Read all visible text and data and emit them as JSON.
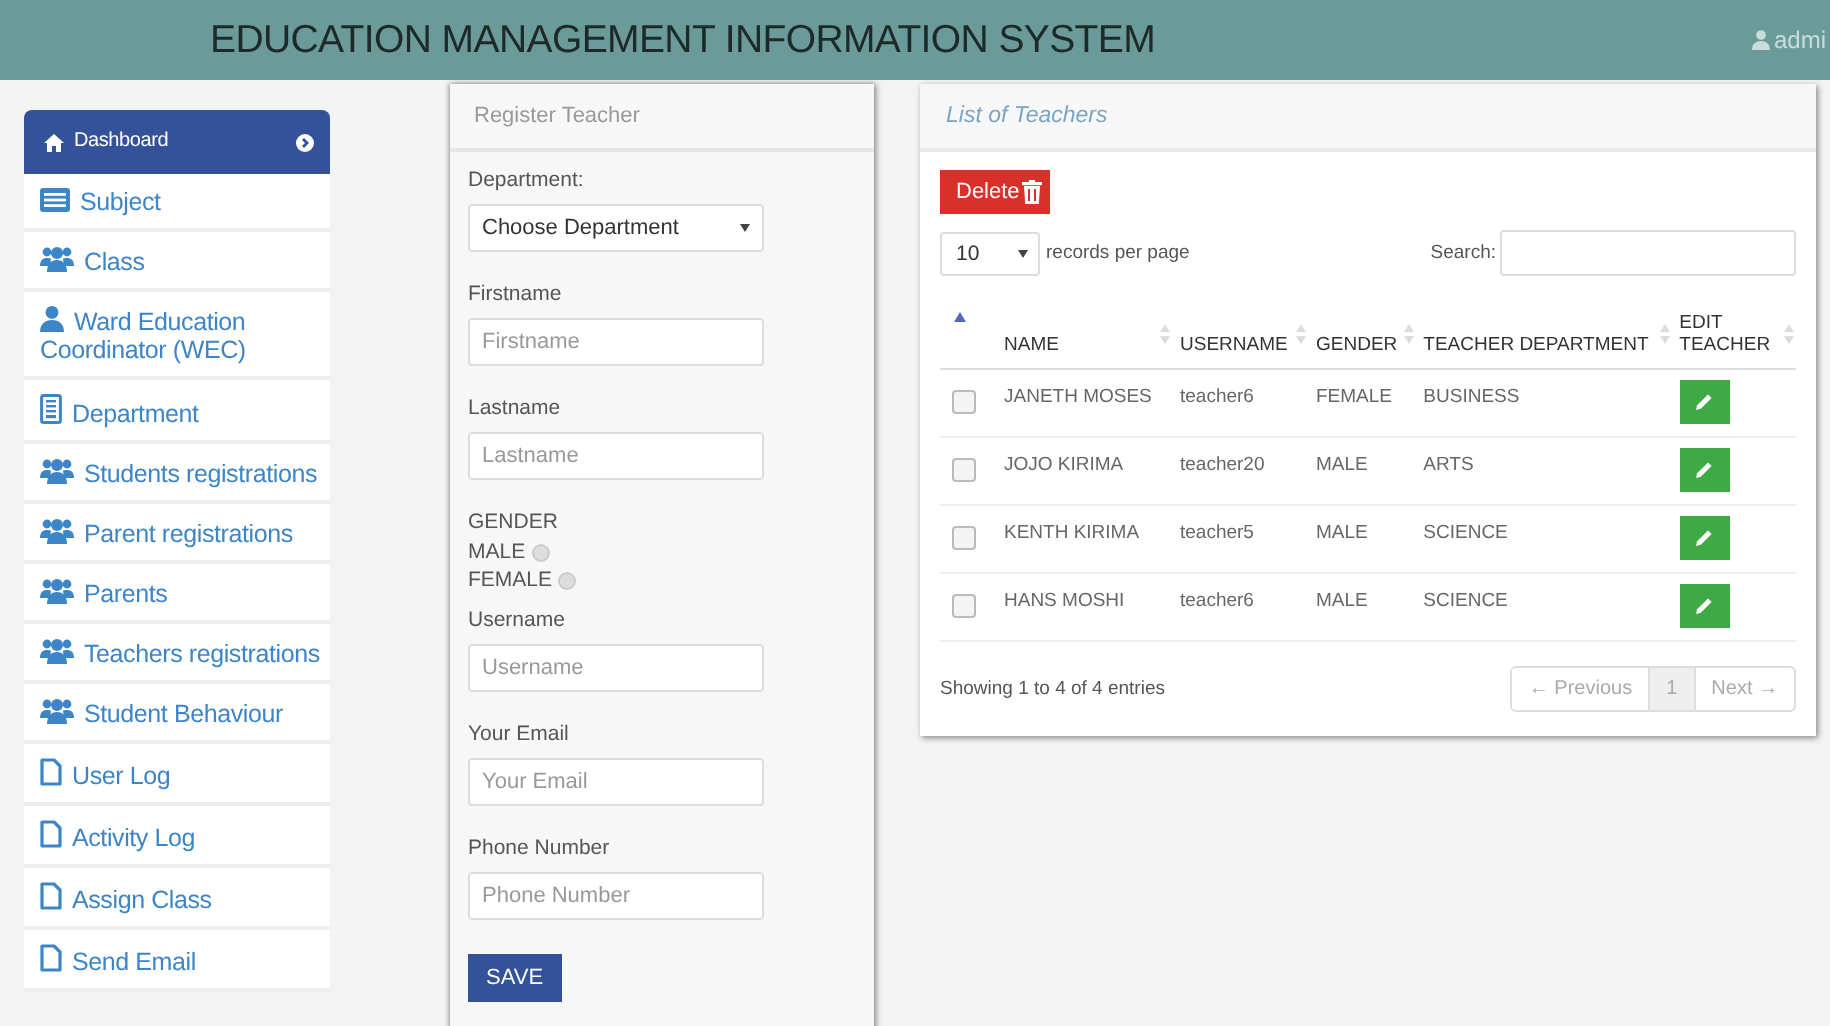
{
  "header": {
    "title": "EDUCATION MANAGEMENT INFORMATION SYSTEM",
    "user": "admi"
  },
  "sidebar": {
    "items": [
      {
        "label": "Dashboard",
        "kind": "header"
      },
      {
        "label": "Subject",
        "kind": "list"
      },
      {
        "label": "Class",
        "kind": "group"
      },
      {
        "label": "Ward Education Coordinator (WEC)",
        "kind": "person"
      },
      {
        "label": "Department",
        "kind": "building"
      },
      {
        "label": "Students registrations",
        "kind": "group"
      },
      {
        "label": "Parent registrations",
        "kind": "group"
      },
      {
        "label": "Parents",
        "kind": "group"
      },
      {
        "label": "Teachers registrations",
        "kind": "group"
      },
      {
        "label": "Student Behaviour",
        "kind": "group"
      },
      {
        "label": "User Log",
        "kind": "file"
      },
      {
        "label": "Activity Log",
        "kind": "file"
      },
      {
        "label": "Assign Class",
        "kind": "file"
      },
      {
        "label": "Send Email",
        "kind": "file"
      }
    ]
  },
  "form": {
    "title": "Register Teacher",
    "fields": [
      {
        "kind": "select",
        "label": "Department:",
        "value": "Choose Department"
      },
      {
        "kind": "text",
        "label": "Firstname",
        "placeholder": "Firstname"
      },
      {
        "kind": "text",
        "label": "Lastname",
        "placeholder": "Lastname"
      },
      {
        "kind": "radio",
        "label": "GENDER",
        "options": [
          {
            "label": "MALE",
            "selected": false
          },
          {
            "label": "FEMALE",
            "selected": false
          }
        ]
      },
      {
        "kind": "text",
        "label": "Username",
        "placeholder": "Username"
      },
      {
        "kind": "text",
        "label": "Your Email",
        "placeholder": "Your Email"
      },
      {
        "kind": "text",
        "label": "Phone Number",
        "placeholder": "Phone Number"
      }
    ],
    "submit": "SAVE"
  },
  "list": {
    "title": "List of Teachers",
    "delete": "Delete",
    "page_size": "10",
    "page_size_label": "records per page",
    "search_label": "Search:",
    "select_column": {
      "sorted": true
    },
    "columns": [
      {
        "label": "NAME",
        "sorted": false
      },
      {
        "label": "USERNAME",
        "sorted": false
      },
      {
        "label": "GENDER",
        "sorted": false
      },
      {
        "label": "TEACHER DEPARTMENT",
        "sorted": false
      },
      {
        "label": "EDIT TEACHER",
        "sorted": false
      }
    ],
    "rows": [
      {
        "checked": false,
        "cells": [
          "JANETH MOSES",
          "teacher6",
          "FEMALE",
          "BUSINESS"
        ]
      },
      {
        "checked": false,
        "cells": [
          "JOJO KIRIMA",
          "teacher20",
          "MALE",
          "ARTS"
        ]
      },
      {
        "checked": false,
        "cells": [
          "KENTH KIRIMA",
          "teacher5",
          "MALE",
          "SCIENCE"
        ]
      },
      {
        "checked": false,
        "cells": [
          "HANS MOSHI",
          "teacher6",
          "MALE",
          "SCIENCE"
        ]
      }
    ],
    "summary": "Showing 1 to 4 of 4 entries",
    "pagination": {
      "previous": {
        "label": "← Previous",
        "disabled": true
      },
      "pages": [
        {
          "label": "1",
          "selected": true
        }
      ],
      "next": {
        "label": "Next →",
        "disabled": true
      }
    }
  }
}
